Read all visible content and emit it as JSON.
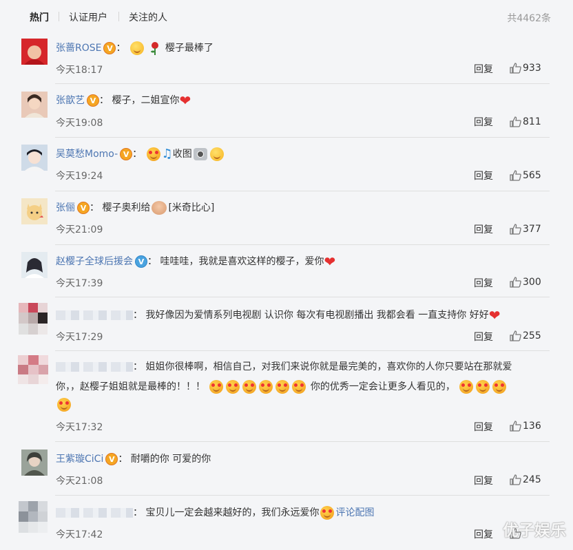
{
  "tabs": [
    "热门",
    "认证用户",
    "关注的人"
  ],
  "total_count": "共4462条",
  "reply_label": "回复",
  "comments": [
    {
      "user": "张蔷ROSE",
      "verified": "orange",
      "content": "樱子最棒了",
      "time": "今天18:17",
      "likes": "933"
    },
    {
      "user": "张歆艺",
      "verified": "orange",
      "content": "樱子，二姐宣你",
      "time": "今天19:08",
      "likes": "811"
    },
    {
      "user": "吴莫愁Momo-",
      "verified": "orange",
      "content": "收图",
      "time": "今天19:24",
      "likes": "565"
    },
    {
      "user": "张俪",
      "verified": "orange",
      "content": "樱子奥利给",
      "content2": "[米奇比心]",
      "time": "今天21:09",
      "likes": "377"
    },
    {
      "user": "赵樱子全球后援会",
      "verified": "blue",
      "content": "哇哇哇，我就是喜欢这样的樱子，爱你",
      "time": "今天17:39",
      "likes": "300"
    },
    {
      "user": "",
      "verified": "",
      "content": "我好像因为爱情系列电视剧 认识你 每次有电视剧播出 我都会看 一直支持你 好好",
      "time": "今天17:29",
      "likes": "255"
    },
    {
      "user": "",
      "verified": "",
      "content": "姐姐你很棒啊，相信自己，对我们来说你就是最完美的，喜欢你的人你只要站在那就爱",
      "content_line2a": "你，，赵樱子姐姐就是最棒的！！！",
      "content_line2b": "你的优秀一定会让更多人看见的，",
      "time": "今天17:32",
      "likes": "136"
    },
    {
      "user": "王紫璇CiCi",
      "verified": "orange",
      "content": "耐嚼的你 可爱的你",
      "time": "今天21:08",
      "likes": "245"
    },
    {
      "user": "",
      "verified": "",
      "content": "宝贝儿一定会越来越好的，我们永远爱你",
      "image_link": "评论配图",
      "time": "今天17:42",
      "likes": ""
    }
  ],
  "watermark": "优子娱乐",
  "colors": {
    "link": "#4d76b2",
    "badge_orange": "#f5a623",
    "badge_blue": "#4aa3df",
    "heart": "#e53030"
  }
}
